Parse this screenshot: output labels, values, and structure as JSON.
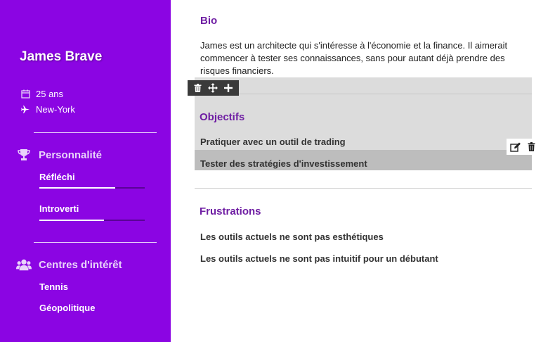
{
  "profile": {
    "name": "James Brave",
    "age": "25 ans",
    "location": "New-York"
  },
  "personality": {
    "title": "Personnalité",
    "traits": [
      {
        "label": "Réfléchi",
        "level": 0.72
      },
      {
        "label": "Introverti",
        "level": 0.61
      }
    ]
  },
  "interests": {
    "title": "Centres d'intérêt",
    "items": [
      "Tennis",
      "Géopolitique"
    ]
  },
  "bio": {
    "title": "Bio",
    "text": "James est un architecte qui s'intéresse à l'économie et la finance. Il aimerait commencer à tester ses connaissances, sans pour autant déjà prendre des risques financiers."
  },
  "objectives": {
    "title": "Objectifs",
    "items": [
      "Pratiquer avec un outil de trading",
      "Tester des stratégies d'investissement"
    ]
  },
  "frustrations": {
    "title": "Frustrations",
    "items": [
      "Les outils actuels ne sont pas esthétiques",
      "Les outils actuels ne sont pas intuitif pour un débutant"
    ]
  },
  "colors": {
    "sidebar": "#8b05e3",
    "heading": "#6f1ea3",
    "highlight": "#dcdcdc",
    "toolbar": "#3a3a3a"
  }
}
